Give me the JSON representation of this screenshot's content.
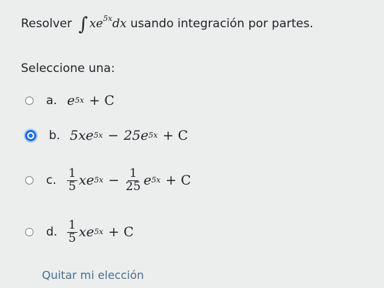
{
  "question": {
    "prefix": "Resolver",
    "integral_symbol": "∫",
    "integrand_base": "xe",
    "integrand_exp": "5x",
    "differential": "dx",
    "suffix": "usando integración por partes."
  },
  "prompt": "Seleccione una:",
  "options": [
    {
      "letter": "a.",
      "selected": false,
      "base": "e",
      "exp": "5x",
      "tail": "+ C"
    },
    {
      "letter": "b.",
      "selected": true,
      "term1_base": "5xe",
      "term1_exp": "5x",
      "op": "−",
      "term2_base": "25e",
      "term2_exp": "5x",
      "tail": "+ C"
    },
    {
      "letter": "c.",
      "selected": false,
      "frac1_num": "1",
      "frac1_den": "5",
      "term1_base": "xe",
      "term1_exp": "5x",
      "op": "−",
      "frac2_num": "1",
      "frac2_den": "25",
      "term2_base": "e",
      "term2_exp": "5x",
      "tail": "+ C"
    },
    {
      "letter": "d.",
      "selected": false,
      "frac1_num": "1",
      "frac1_den": "5",
      "term1_base": "xe",
      "term1_exp": "5x",
      "tail": "+ C"
    }
  ],
  "clear_choice": "Quitar mi elección",
  "colors": {
    "background": "#eceeee",
    "radio_selected": "#1f6fe0",
    "link": "#4a6f8d"
  }
}
